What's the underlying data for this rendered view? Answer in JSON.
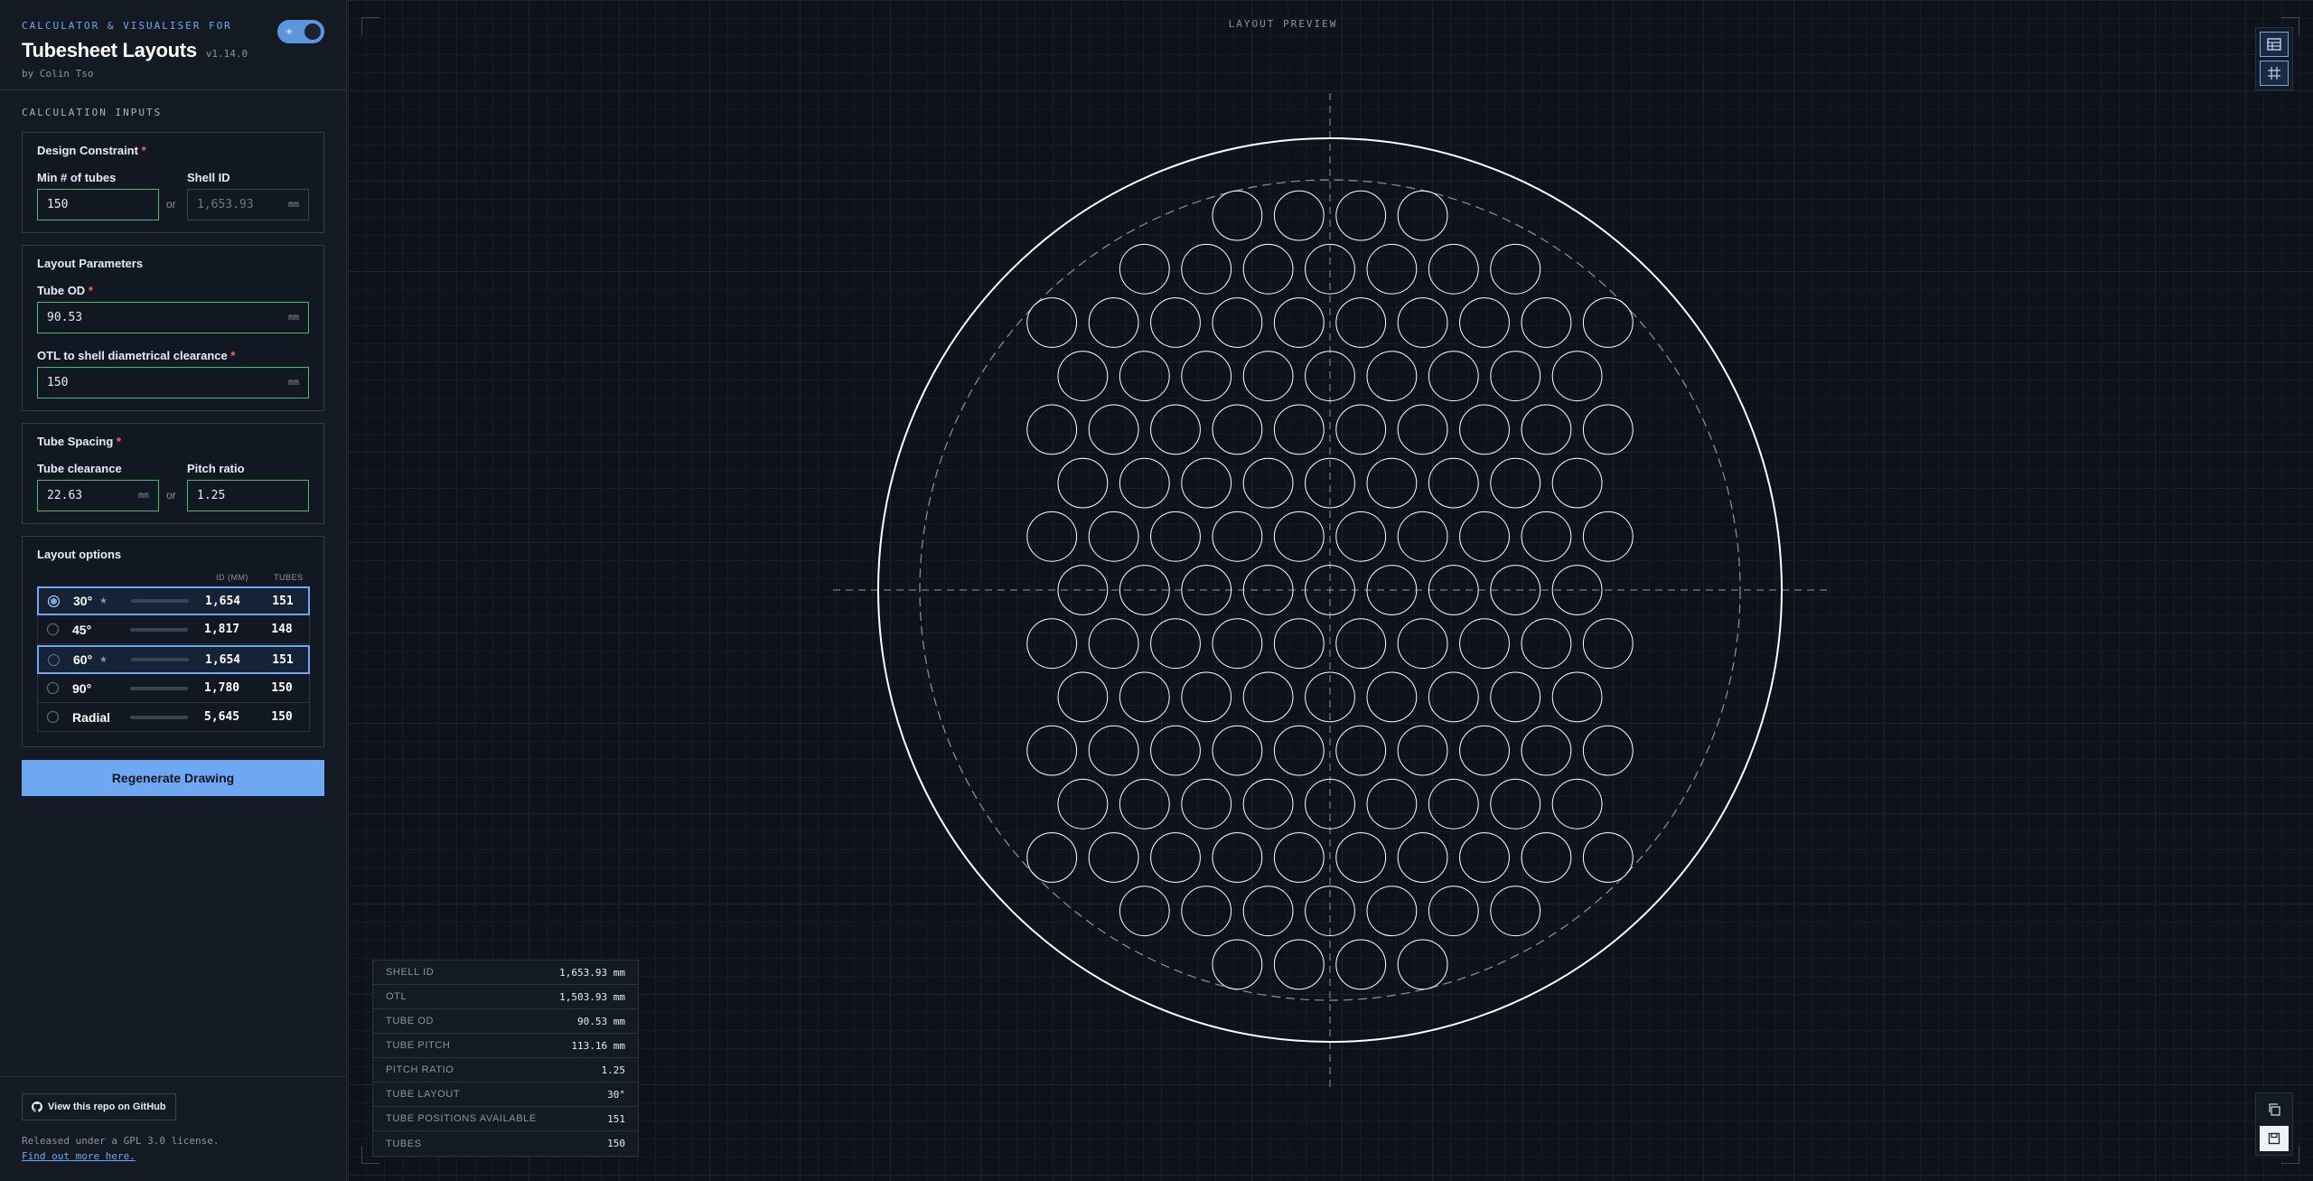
{
  "header": {
    "eyebrow": "CALCULATOR & VISUALISER FOR",
    "title": "Tubesheet Layouts",
    "version": "v1.14.0",
    "byline": "by Colin Tso",
    "theme_toggle_icon": "☀"
  },
  "inputs_title": "CALCULATION INPUTS",
  "design": {
    "title": "Design Constraint",
    "required": "*",
    "min_tubes_label": "Min # of tubes",
    "min_tubes_value": "150",
    "or": "or",
    "shell_id_label": "Shell ID",
    "shell_id_placeholder": "1,653.93",
    "unit": "mm"
  },
  "layout_params": {
    "title": "Layout Parameters",
    "tube_od_label": "Tube OD",
    "tube_od_value": "90.53",
    "otl_label": "OTL to shell diametrical clearance",
    "otl_value": "150",
    "unit": "mm",
    "required": "*"
  },
  "spacing": {
    "title": "Tube Spacing",
    "required": "*",
    "clearance_label": "Tube clearance",
    "clearance_value": "22.63",
    "unit": "mm",
    "or": "or",
    "pitch_label": "Pitch ratio",
    "pitch_value": "1.25"
  },
  "layout_options": {
    "title": "Layout options",
    "col_id": "ID (MM)",
    "col_tubes": "TUBES",
    "options": [
      {
        "name": "30°",
        "star": "★",
        "bar_fraction": 0.12,
        "id": "1,654",
        "tubes": "151",
        "selected": true,
        "highlighted": true
      },
      {
        "name": "45°",
        "star": "",
        "bar_fraction": 0.3,
        "id": "1,817",
        "tubes": "148",
        "selected": false,
        "highlighted": false
      },
      {
        "name": "60°",
        "star": "★",
        "bar_fraction": 0.12,
        "id": "1,654",
        "tubes": "151",
        "selected": false,
        "highlighted": true
      },
      {
        "name": "90°",
        "star": "",
        "bar_fraction": 0.25,
        "id": "1,780",
        "tubes": "150",
        "selected": false,
        "highlighted": false
      },
      {
        "name": "Radial",
        "star": "",
        "bar_fraction": 1.0,
        "id": "5,645",
        "tubes": "150",
        "selected": false,
        "highlighted": false
      }
    ]
  },
  "regenerate_label": "Regenerate Drawing",
  "footer": {
    "github_label": "View this repo on GitHub",
    "license": "Released under a GPL 3.0 license.",
    "more": "Find out more here."
  },
  "preview": {
    "label": "LAYOUT PREVIEW",
    "tube_layout_deg": 30,
    "tube_count": 151
  },
  "summary": [
    {
      "key": "SHELL ID",
      "value": "1,653.93 mm"
    },
    {
      "key": "OTL",
      "value": "1,503.93 mm"
    },
    {
      "key": "TUBE OD",
      "value": "90.53 mm"
    },
    {
      "key": "TUBE PITCH",
      "value": "113.16 mm"
    },
    {
      "key": "PITCH RATIO",
      "value": "1.25"
    },
    {
      "key": "TUBE LAYOUT",
      "value": "30°"
    },
    {
      "key": "TUBE POSITIONS AVAILABLE",
      "value": "151"
    },
    {
      "key": "TUBES",
      "value": "150"
    }
  ],
  "colors": {
    "accent": "#6fa8f2",
    "valid_border": "#3fbd69",
    "required": "#ff5d72",
    "drawing": "#ffffff"
  },
  "icons": {
    "toolbar_top": [
      "table-icon",
      "grid-icon"
    ],
    "toolbar_bottom": [
      "copy-icon",
      "save-icon"
    ],
    "github": "github-icon"
  }
}
